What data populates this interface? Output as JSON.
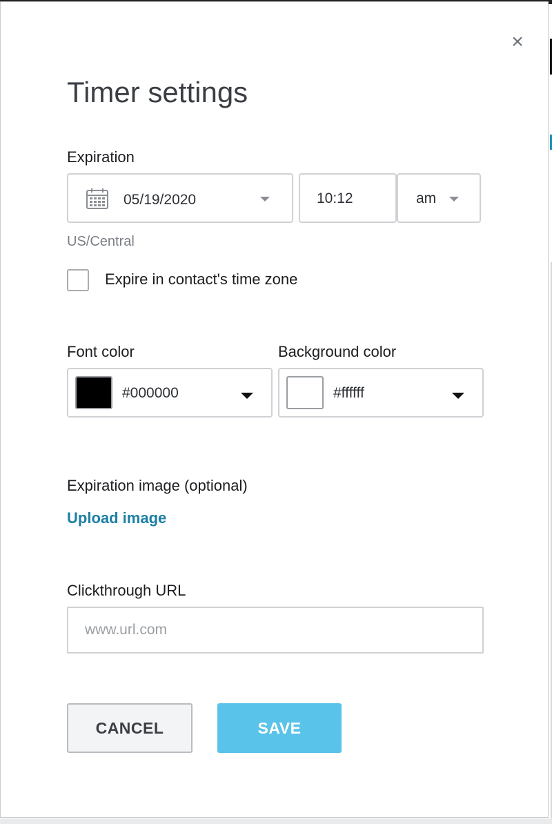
{
  "dialog": {
    "title": "Timer settings",
    "close_glyph": "×"
  },
  "expiration": {
    "label": "Expiration",
    "date": "05/19/2020",
    "time": "10:12",
    "meridiem": "am",
    "timezone": "US/Central",
    "contact_tz_checkbox": {
      "label": "Expire in contact's time zone",
      "checked": false
    },
    "icons": {
      "date": "calendar-icon",
      "dropdown": "chevron-down-icon"
    }
  },
  "font_color": {
    "label": "Font color",
    "value": "#000000",
    "swatch": "#000000"
  },
  "background_color": {
    "label": "Background color",
    "value": "#ffffff",
    "swatch": "#ffffff"
  },
  "expiration_image": {
    "label": "Expiration image (optional)",
    "upload_link": "Upload image"
  },
  "clickthrough": {
    "label": "Clickthrough URL",
    "value": "",
    "placeholder": "www.url.com"
  },
  "actions": {
    "cancel": "CANCEL",
    "save": "SAVE"
  },
  "colors": {
    "accent_link": "#1c7fa3",
    "primary_button": "#5ac3e9"
  }
}
